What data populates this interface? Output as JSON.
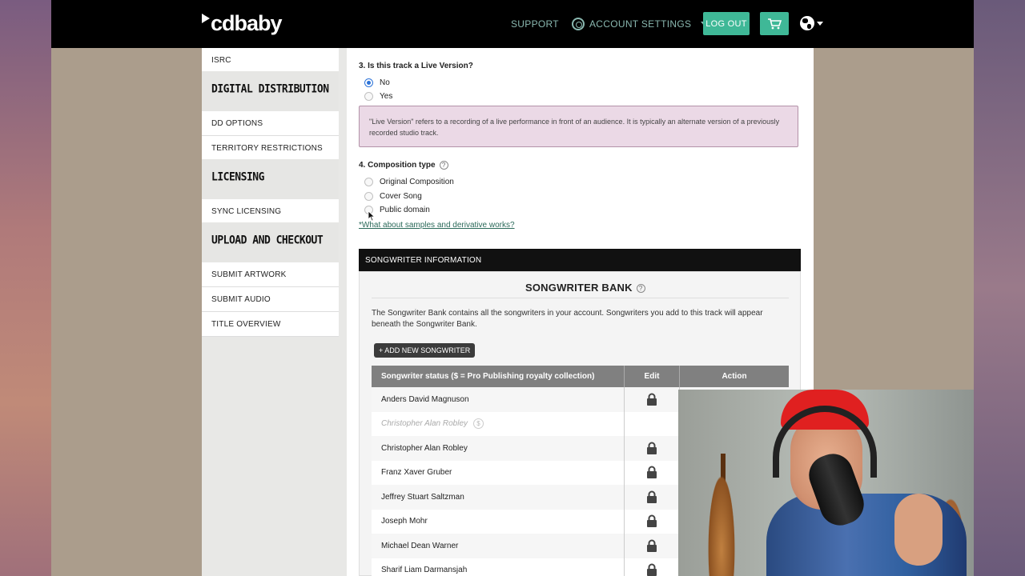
{
  "header": {
    "logo_text": "cdbaby",
    "support_label": "SUPPORT",
    "account_settings_label": "ACCOUNT SETTINGS",
    "logout_label": "LOG OUT"
  },
  "sidebar": {
    "items": [
      {
        "type": "item",
        "label": "ISRC"
      },
      {
        "type": "head",
        "label": "DIGITAL DISTRIBUTION"
      },
      {
        "type": "item",
        "label": "DD OPTIONS"
      },
      {
        "type": "item",
        "label": "TERRITORY RESTRICTIONS"
      },
      {
        "type": "head",
        "label": "LICENSING"
      },
      {
        "type": "item",
        "label": "SYNC LICENSING"
      },
      {
        "type": "head",
        "label": "UPLOAD AND CHECKOUT"
      },
      {
        "type": "item",
        "label": "SUBMIT ARTWORK"
      },
      {
        "type": "item",
        "label": "SUBMIT AUDIO"
      },
      {
        "type": "item",
        "label": "TITLE OVERVIEW"
      }
    ]
  },
  "live_version": {
    "question": "3. Is this track a Live Version?",
    "options": [
      "No",
      "Yes"
    ],
    "selected": "No",
    "note": "\"Live Version\" refers to a recording of a live performance in front of an audience. It is typically an alternate version of a previously recorded studio track."
  },
  "composition": {
    "question": "4. Composition type",
    "help": "?",
    "options": [
      "Original Composition",
      "Cover Song",
      "Public domain"
    ],
    "link": "*What about samples and derivative works?"
  },
  "songwriter": {
    "section_title": "SONGWRITER INFORMATION",
    "bank_title": "SONGWRITER BANK",
    "bank_help": "?",
    "description": "The Songwriter Bank contains all the songwriters in your account. Songwriters you add to this track will appear beneath the Songwriter Bank.",
    "add_button": "+ ADD NEW SONGWRITER",
    "columns": [
      "Songwriter status ($ = Pro Publishing royalty collection)",
      "Edit",
      "Action"
    ],
    "rows": [
      {
        "name": "Anders David Magnuson",
        "locked": true,
        "muted": false
      },
      {
        "name": "Christopher Alan Robley",
        "locked": false,
        "muted": true,
        "badge": "$"
      },
      {
        "name": "Christopher Alan Robley",
        "locked": true,
        "muted": false
      },
      {
        "name": "Franz Xaver Gruber",
        "locked": true,
        "muted": false
      },
      {
        "name": "Jeffrey Stuart Saltzman",
        "locked": true,
        "muted": false
      },
      {
        "name": "Joseph Mohr",
        "locked": true,
        "muted": false
      },
      {
        "name": "Michael Dean Warner",
        "locked": true,
        "muted": false
      },
      {
        "name": "Sharif Liam Darmansjah",
        "locked": true,
        "muted": false
      }
    ]
  },
  "colors": {
    "accent_green": "#3fb897",
    "radio_blue": "#2d73d8",
    "note_bg": "#ebd9e6"
  }
}
